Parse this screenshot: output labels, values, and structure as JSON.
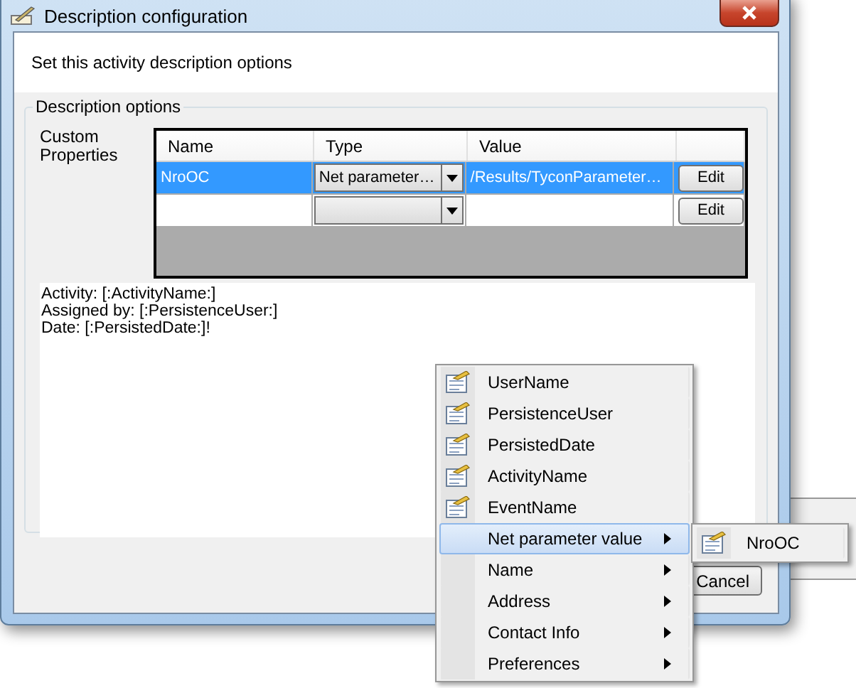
{
  "window": {
    "title": "Description configuration"
  },
  "header": {
    "instruction": "Set this activity description options"
  },
  "group": {
    "legend": "Description options",
    "label": "Custom Properties"
  },
  "grid": {
    "columns": [
      "Name",
      "Type",
      "Value"
    ],
    "rows": [
      {
        "name": "NroOC",
        "type": "Net parameter…",
        "value": "/Results/TyconParameter…",
        "button": "Edit",
        "selected": true
      },
      {
        "button": "Edit",
        "selected": false
      }
    ]
  },
  "description_lines": [
    "Activity: [:ActivityName:]",
    "Assigned by: [:PersistenceUser:]",
    "Date: [:PersistedDate:]!"
  ],
  "buttons": [
    {
      "label": "Cancel"
    }
  ],
  "context_menu": {
    "items": [
      {
        "label": "UserName",
        "kind": "field",
        "selected": false
      },
      {
        "label": "PersistenceUser",
        "kind": "field",
        "selected": false
      },
      {
        "label": "PersistedDate",
        "kind": "field",
        "selected": false
      },
      {
        "label": "ActivityName",
        "kind": "field",
        "selected": false
      },
      {
        "label": "EventName",
        "kind": "field",
        "selected": false
      },
      {
        "label": "Net parameter value",
        "kind": "submenu",
        "selected": true
      },
      {
        "label": "Name",
        "kind": "submenu",
        "selected": false
      },
      {
        "label": "Address",
        "kind": "submenu",
        "selected": false
      },
      {
        "label": "Contact Info",
        "kind": "submenu",
        "selected": false
      },
      {
        "label": "Preferences",
        "kind": "submenu",
        "selected": false
      }
    ]
  },
  "submenu": {
    "items": [
      {
        "label": "NroOC",
        "kind": "field"
      }
    ]
  }
}
